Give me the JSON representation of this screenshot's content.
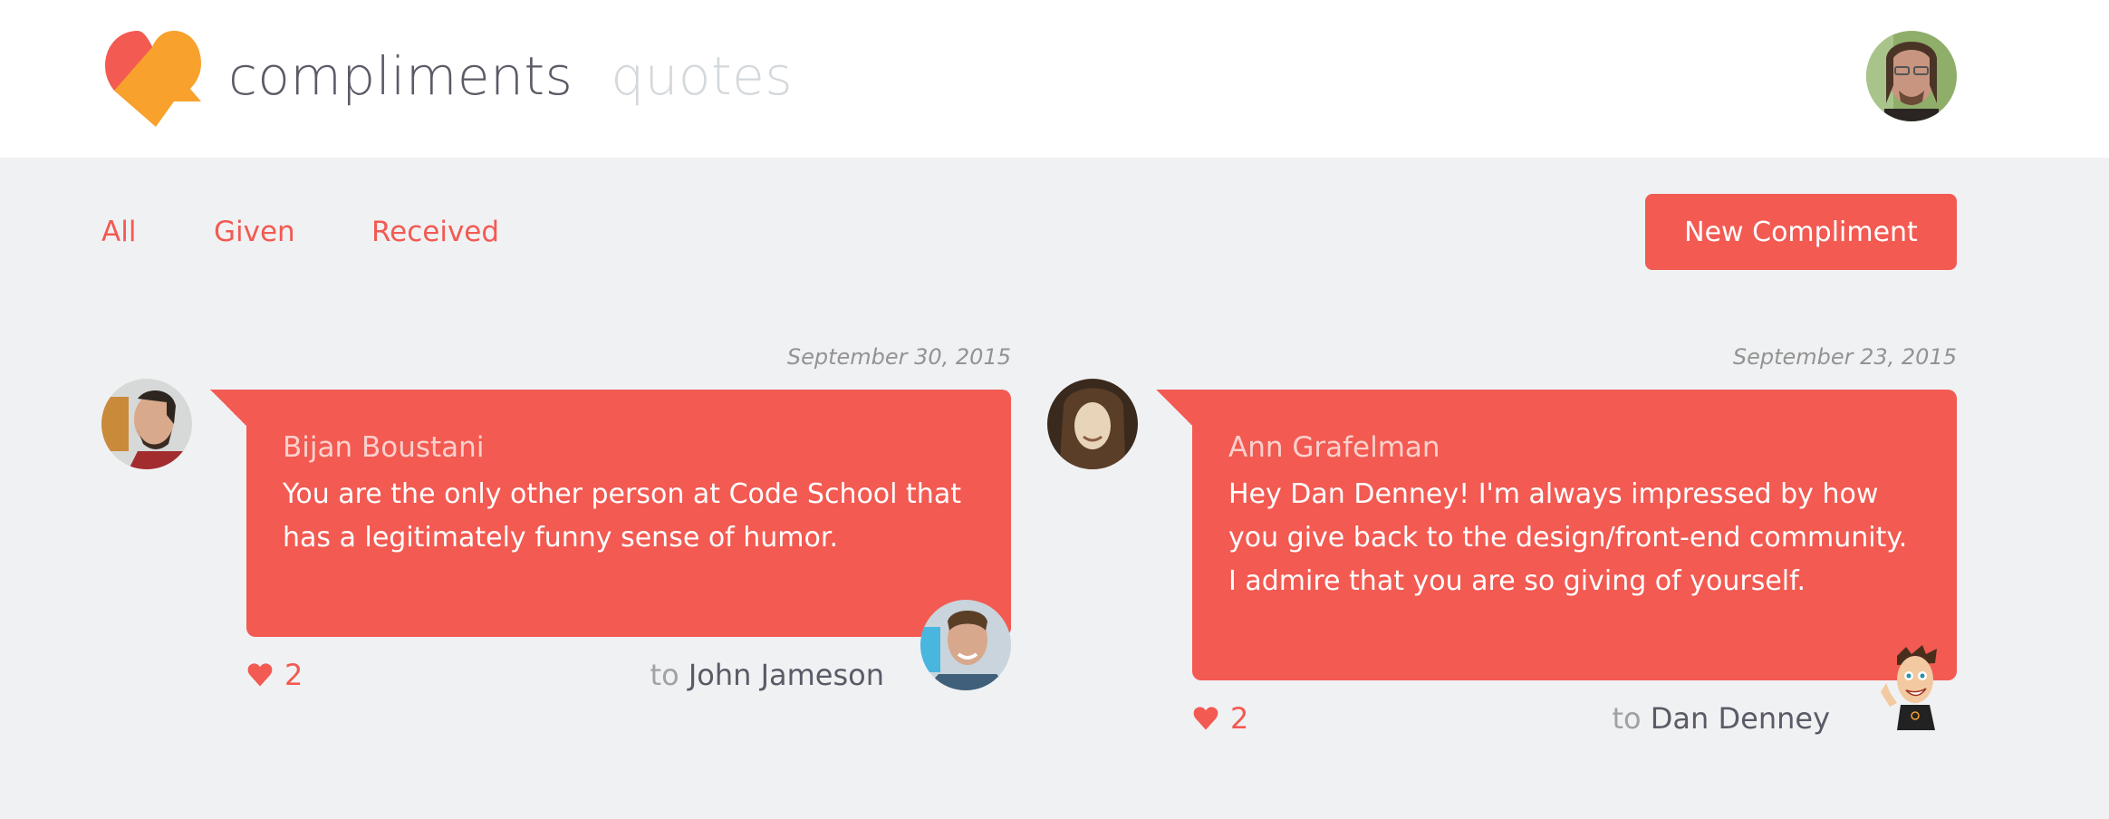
{
  "header": {
    "logo_icon": "heart-speech-bubble-logo",
    "brand_primary": "compliments",
    "brand_secondary": "quotes",
    "user_avatar": "current-user-avatar"
  },
  "nav": {
    "tabs": [
      {
        "label": "All"
      },
      {
        "label": "Given"
      },
      {
        "label": "Received"
      }
    ],
    "new_button_label": "New Compliment"
  },
  "colors": {
    "accent": "#f25a52",
    "logo_orange": "#f8a12c",
    "background": "#f0f1f3",
    "text_dark": "#5b5a66",
    "text_muted": "#d3d8dc"
  },
  "compliments": [
    {
      "date": "September 30, 2015",
      "sender": "Bijan Boustani",
      "message": "You are the only other person at Code School that has a legitimately funny sense of humor.",
      "likes": "2",
      "to_label": "to",
      "recipient": "John Jameson"
    },
    {
      "date": "September 23, 2015",
      "sender": "Ann Grafelman",
      "message": "Hey Dan Denney! I'm always impressed by how you give back to the design/front-end community. I admire that you are so giving of yourself.",
      "likes": "2",
      "to_label": "to",
      "recipient": "Dan Denney"
    }
  ]
}
